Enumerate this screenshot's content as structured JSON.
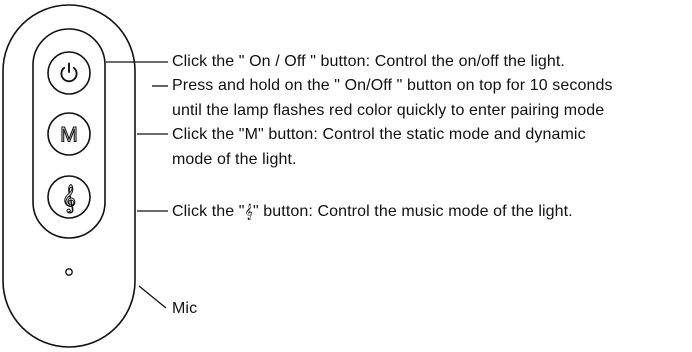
{
  "remote": {
    "buttons": [
      {
        "name": "power",
        "glyph": "⏻",
        "icon": "power-icon"
      },
      {
        "name": "mode",
        "glyph": "M",
        "icon": "m-letter-icon"
      },
      {
        "name": "music",
        "glyph": "𝄞",
        "icon": "treble-clef-icon"
      }
    ],
    "colors": {
      "stroke": "#111111",
      "background": "#ffffff"
    }
  },
  "annotations": {
    "power_label": "Click the \" On / Off \" button: Control the on/off the light.",
    "pairing_line1": "Press and hold on the \" On/Off \" button on top for 10 seconds",
    "pairing_line2": "until the lamp flashes red color quickly to enter pairing mode",
    "mode_line1": "Click the \"M\" button: Control the static mode and dynamic",
    "mode_line2": "mode of the light.",
    "music_prefix": "Click the \"",
    "music_glyph": "𝄞",
    "music_suffix": "\" button: Control the music mode of the light.",
    "mic_label": "Mic"
  }
}
